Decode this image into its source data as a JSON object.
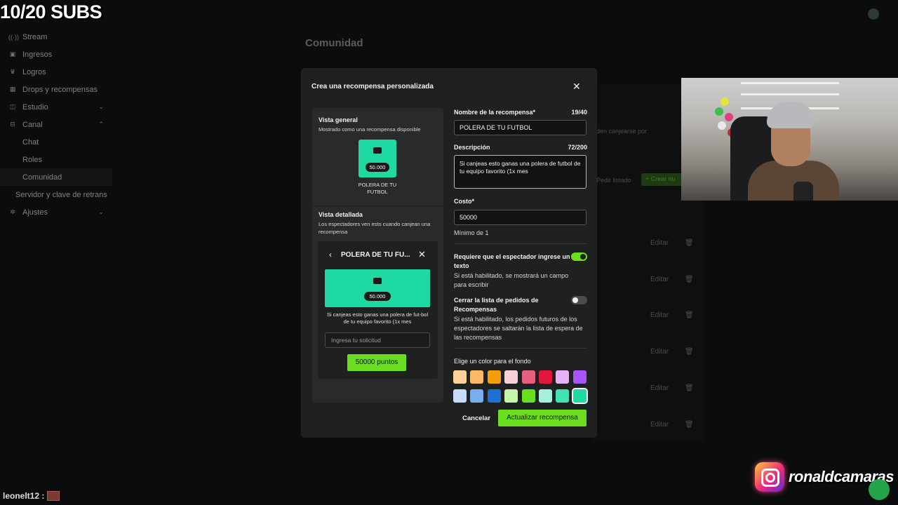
{
  "overlay": {
    "subs_counter": "10/20 SUBS",
    "chat_user": "leonelt12 :",
    "instagram_handle": "ronaldcamaras"
  },
  "sidebar": {
    "items": [
      {
        "label": "Stream",
        "icon": "broadcast-icon"
      },
      {
        "label": "Ingresos",
        "icon": "wallet-icon"
      },
      {
        "label": "Logros",
        "icon": "trophy-icon"
      },
      {
        "label": "Drops y recompensas",
        "icon": "gift-icon"
      },
      {
        "label": "Estudio",
        "icon": "studio-icon"
      },
      {
        "label": "Canal",
        "icon": "channel-icon"
      },
      {
        "label": "Chat"
      },
      {
        "label": "Roles"
      },
      {
        "label": "Comunidad"
      },
      {
        "label": "Servidor y clave de retrans"
      },
      {
        "label": "Ajustes",
        "icon": "gear-icon"
      }
    ]
  },
  "background": {
    "page_title": "Comunidad",
    "hint_text": "den canjearse por",
    "list_button": "Pedir listado",
    "create_button": "Crear nu",
    "edit_label": "Editar"
  },
  "modal": {
    "title": "Crea una recompensa personalizada",
    "preview": {
      "overview_title": "Vista general",
      "overview_sub": "Mostrado como una recompensa disponible",
      "tile_cost": "50.000",
      "tile_name": "POLERA DE TU FUTBOL",
      "detail_title": "Vista detallada",
      "detail_sub": "Los espectadores ven esto cuando canjean una recompensa",
      "detail_header": "POLERA DE TU FU...",
      "detail_cost": "50.000",
      "detail_desc": "Si canjeas esto ganas una polera de fut-bol de tu equipo favorito (1x mes",
      "request_placeholder": "Ingresa tu solicitud",
      "redeem_button": "50000 puntos"
    },
    "form": {
      "name_label": "Nombre de la recompensa*",
      "name_count": "19/40",
      "name_value": "POLERA DE TU FUTBOL",
      "desc_label": "Descripción",
      "desc_count": "72/200",
      "desc_value": "Si canjeas esto ganas una polera de futbol de tu equipo favorito (1x mes",
      "cost_label": "Costo*",
      "cost_value": "50000",
      "cost_help": "Mínimo de 1",
      "require_text_label": "Requiere que el espectador ingrese un texto",
      "require_text_help": "Si está habilitado, se mostrará un campo para escribir",
      "require_text_on": true,
      "close_queue_label": "Cerrar la lista de pedidos de Recompensas",
      "close_queue_help": "Si está habilitado, los pedidos futuros de los espectadores se saltarán la lista de espera de las recompensas",
      "close_queue_on": false,
      "color_label": "Elige un color para el fondo",
      "colors": [
        "#fdd29a",
        "#fbb865",
        "#f59e0b",
        "#f9cfd8",
        "#e8607f",
        "#e0173d",
        "#e6b2f5",
        "#a855f7",
        "#c8daf7",
        "#7aaef0",
        "#1f6fd6",
        "#c4f5a8",
        "#6bdf1f",
        "#a8f0de",
        "#3fe3b4",
        "#1ed9a2"
      ],
      "selected_color": "#1ed9a2",
      "cancel_label": "Cancelar",
      "submit_label": "Actualizar recompensa"
    }
  }
}
